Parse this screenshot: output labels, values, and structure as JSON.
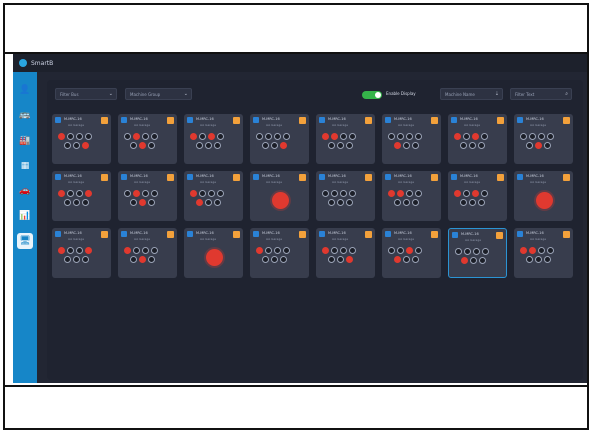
{
  "app": {
    "brand": "SmartB"
  },
  "toolbar": {
    "filter1": "Filter Bus",
    "filter2": "Machine Group",
    "toggle_label": "Enable Display",
    "select3": "Machine Name",
    "search_placeholder": "Filter Text"
  },
  "sidebar": {
    "items": [
      {
        "icon": "user-icon",
        "glyph": "👤"
      },
      {
        "icon": "bus-icon",
        "glyph": "🚌"
      },
      {
        "icon": "factory-icon",
        "glyph": "🏭"
      },
      {
        "icon": "list-icon",
        "glyph": "▦"
      },
      {
        "icon": "car-icon",
        "glyph": "🚗"
      },
      {
        "icon": "chart-icon",
        "glyph": "📊"
      },
      {
        "icon": "monitor-icon",
        "glyph": "🖥"
      }
    ]
  },
  "machine_card": {
    "title": "M-MRC-16",
    "subtitle": "AA Garage"
  },
  "colors": {
    "accent": "#1686c8",
    "badge": "#f3a13b",
    "alert": "#e0392f",
    "ok": "#35b34a"
  }
}
